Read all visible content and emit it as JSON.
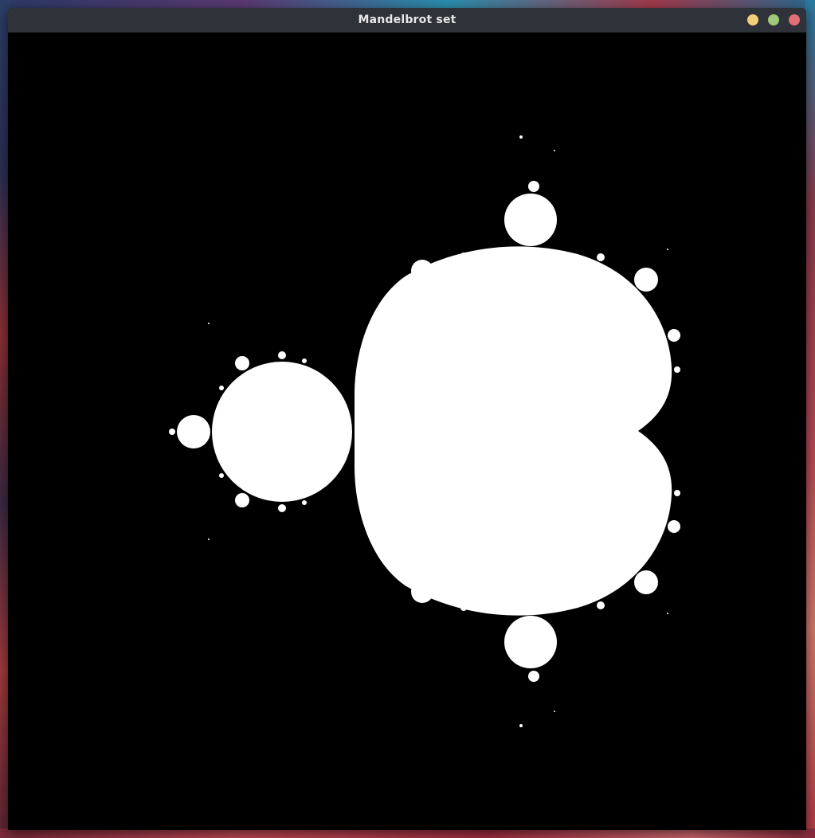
{
  "window": {
    "title": "Mandelbrot set"
  },
  "window_controls": {
    "minimize_color": "#f0cf78",
    "maximize_color": "#9fc87a",
    "close_color": "#e07076",
    "minimize_icon": "minimize-icon",
    "maximize_icon": "maximize-icon",
    "close_icon": "close-icon"
  },
  "canvas": {
    "background_color": "#000000",
    "set_color": "#ffffff"
  }
}
